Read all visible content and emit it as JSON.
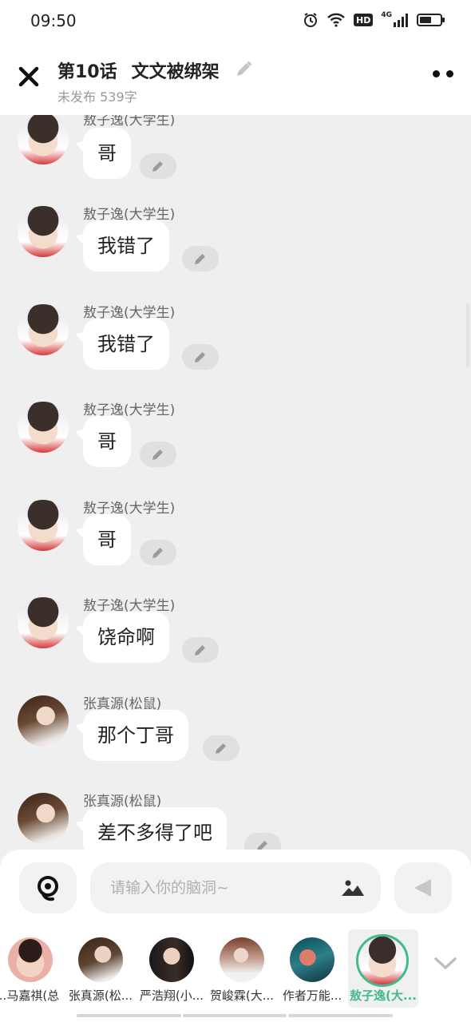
{
  "status_bar": {
    "time": "09:50",
    "icons": [
      "alarm-icon",
      "wifi-icon",
      "hd-icon",
      "4g-signal-icon",
      "battery-icon"
    ],
    "hd_label": "HD",
    "network_label": "4G"
  },
  "header": {
    "close_icon": "close-icon",
    "episode": "第10话",
    "title": "文文被绑架",
    "edit_icon": "pencil-icon",
    "subtitle": "未发布 539字",
    "more_icon": "more-dots-icon"
  },
  "messages": [
    {
      "sender": "敖子逸(大学生)",
      "text": "哥",
      "avatar": "boy"
    },
    {
      "sender": "敖子逸(大学生)",
      "text": "我错了",
      "avatar": "boy"
    },
    {
      "sender": "敖子逸(大学生)",
      "text": "我错了",
      "avatar": "boy"
    },
    {
      "sender": "敖子逸(大学生)",
      "text": "哥",
      "avatar": "boy"
    },
    {
      "sender": "敖子逸(大学生)",
      "text": "哥",
      "avatar": "boy"
    },
    {
      "sender": "敖子逸(大学生)",
      "text": "饶命啊",
      "avatar": "boy"
    },
    {
      "sender": "张真源(松鼠)",
      "text": "那个丁哥",
      "avatar": "dark"
    },
    {
      "sender": "张真源(松鼠)",
      "text": "差不多得了吧",
      "avatar": "dark"
    }
  ],
  "composer": {
    "voice_icon": "voice-bubble-icon",
    "placeholder": "请输入你的脑洞~",
    "image_icon": "image-icon",
    "send_icon": "send-icon"
  },
  "characters": [
    {
      "name": "马嘉祺(总...",
      "active": false
    },
    {
      "name": "张真源(松...",
      "active": false
    },
    {
      "name": "严浩翔(小...",
      "active": false
    },
    {
      "name": "贺峻霖(大...",
      "active": false
    },
    {
      "name": "作者万能...",
      "active": false
    },
    {
      "name": "敖子逸(大...",
      "active": true
    }
  ],
  "collapse_icon": "chevron-down-icon",
  "colors": {
    "accent": "#44b98a",
    "background": "#efefef",
    "bubble": "#ffffff"
  }
}
